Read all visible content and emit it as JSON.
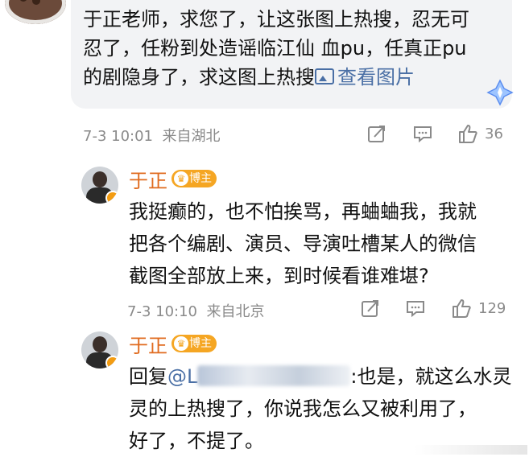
{
  "top_comment": {
    "text_line1": "于正老师，求您了，让这张图上热搜，忍无可",
    "text_line2": "忍了，任粉到处造谣临江仙 血pu，任真正pu",
    "text_line3": "的剧隐身了，求这图上热搜",
    "view_image_label": "查看图片",
    "timestamp": "7-3 10:01",
    "location": "来自湖北",
    "like_count": "36"
  },
  "reply1": {
    "author": "于正",
    "badge": "博主",
    "text_line1": "我挺癫的，也不怕挨骂，再蛐蛐我，我就",
    "text_line2": "把各个编剧、演员、导演吐槽某人的微信",
    "text_line3": "截图全部放上来，到时候看谁难堪?",
    "timestamp": "7-3 10:10",
    "location": "来自北京",
    "like_count": "129"
  },
  "reply2": {
    "author": "于正",
    "badge": "博主",
    "reply_prefix": "回复",
    "mention": "@L",
    "text_line1_tail": ":也是，就这么水灵",
    "text_line2": "灵的上热搜了，你说我怎么又被利用了，",
    "text_line3": "好了，不提了。"
  },
  "colors": {
    "name": "#e06b1f",
    "badge": "#f5a623",
    "link": "#4a6fa5",
    "meta": "#8a8a8a"
  }
}
